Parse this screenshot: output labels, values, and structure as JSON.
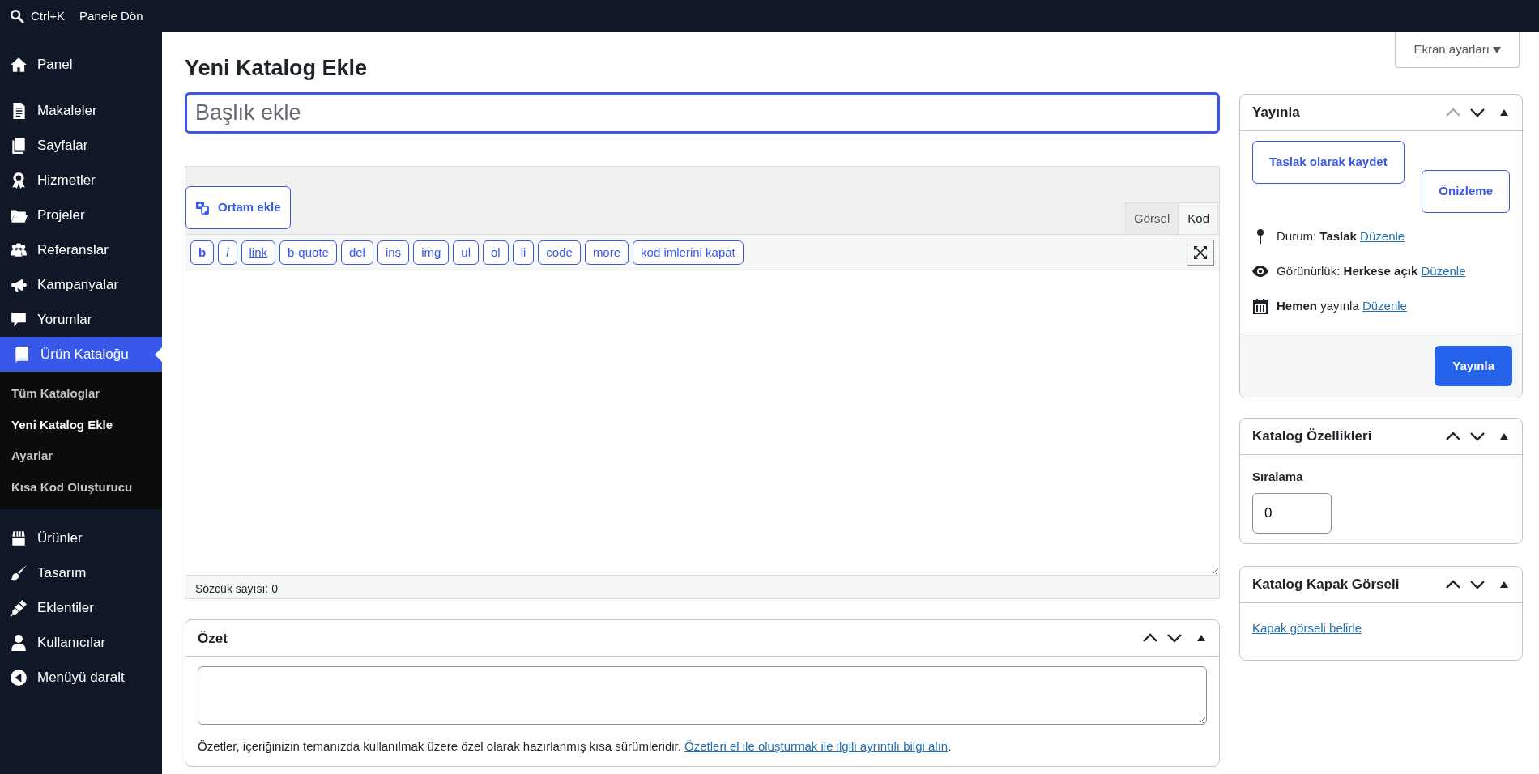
{
  "top_bar": {
    "search_shortcut": "Ctrl+K",
    "back_link": "Panele Dön"
  },
  "sidebar": {
    "items": [
      {
        "label": "Panel",
        "selected": false
      },
      {
        "label": "Makaleler",
        "selected": false
      },
      {
        "label": "Sayfalar",
        "selected": false
      },
      {
        "label": "Hizmetler",
        "selected": false
      },
      {
        "label": "Projeler",
        "selected": false
      },
      {
        "label": "Referanslar",
        "selected": false
      },
      {
        "label": "Kampanyalar",
        "selected": false
      },
      {
        "label": "Yorumlar",
        "selected": false
      },
      {
        "label": "Ürün Kataloğu",
        "selected": true,
        "children": [
          {
            "label": "Tüm Kataloglar",
            "selected": false
          },
          {
            "label": "Yeni Katalog Ekle",
            "selected": true
          },
          {
            "label": "Ayarlar",
            "selected": false
          },
          {
            "label": "Kısa Kod Oluşturucu",
            "selected": false
          }
        ]
      },
      {
        "label": "Ürünler",
        "selected": false
      },
      {
        "label": "Tasarım",
        "selected": false
      },
      {
        "label": "Eklentiler",
        "selected": false
      },
      {
        "label": "Kullanıcılar",
        "selected": false
      },
      {
        "label": "Menüyü daralt",
        "selected": false
      }
    ]
  },
  "screen_options": "Ekran ayarları",
  "page_title": "Yeni Katalog Ekle",
  "title_field": {
    "placeholder": "Başlık ekle"
  },
  "editor": {
    "media_button": "Ortam ekle",
    "tabs": [
      {
        "label": "Görsel",
        "selected": false
      },
      {
        "label": "Kod",
        "selected": true
      }
    ],
    "quicktags": [
      {
        "label": "b",
        "kind": "bold"
      },
      {
        "label": "i",
        "kind": "italic"
      },
      {
        "label": "link",
        "kind": "underline"
      },
      {
        "label": "b-quote",
        "kind": "plain"
      },
      {
        "label": "del",
        "kind": "strike"
      },
      {
        "label": "ins",
        "kind": "plain"
      },
      {
        "label": "img",
        "kind": "plain"
      },
      {
        "label": "ul",
        "kind": "plain"
      },
      {
        "label": "ol",
        "kind": "plain"
      },
      {
        "label": "li",
        "kind": "plain"
      },
      {
        "label": "code",
        "kind": "plain"
      },
      {
        "label": "more",
        "kind": "plain"
      },
      {
        "label": "kod imlerini kapat",
        "kind": "plain"
      }
    ],
    "word_count": "Sözcük sayısı: 0"
  },
  "excerpt": {
    "title": "Özet",
    "move_up_disabled": false,
    "help": "Özetler, içeriğinizin temanızda kullanılmak üzere özel olarak hazırlanmış kısa sürümleridir.",
    "help_link": "Özetleri el ile oluşturmak ile ilgili ayrıntılı bilgi alın",
    "help_end": "."
  },
  "publish": {
    "title": "Yayınla",
    "move_up_disabled": true,
    "save_draft": "Taslak olarak kaydet",
    "preview": "Önizleme",
    "meta": [
      {
        "text": "Durum: **Taslak**",
        "link": "Düzenle"
      },
      {
        "text": "Görünürlük: **Herkese açık**",
        "link": "Düzenle"
      },
      {
        "text": "**Hemen** yayınla",
        "link": "Düzenle"
      }
    ],
    "publish_button": "Yayınla"
  },
  "catalog_properties": {
    "title": "Katalog Özellikleri",
    "move_up_disabled": false,
    "field_label": "Sıralama",
    "field_value": "0"
  },
  "cover_image": {
    "title": "Katalog Kapak Görseli",
    "move_up_disabled": false,
    "link": "Kapak görseli belirle"
  }
}
